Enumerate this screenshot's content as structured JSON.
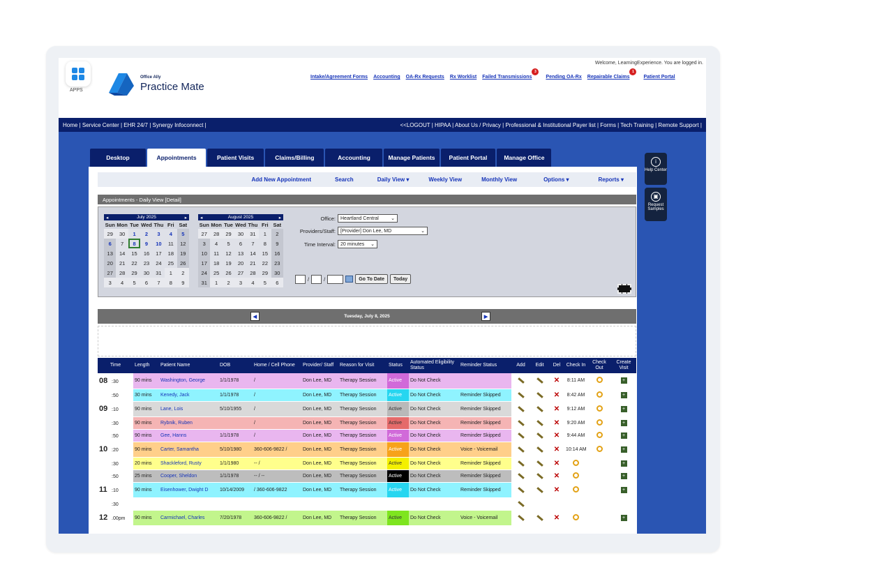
{
  "header": {
    "apps_label": "APPS",
    "brand_top": "Office Ally",
    "brand_name": "Practice Mate",
    "welcome": "Welcome, LearningExperience. You are logged in.",
    "links": [
      {
        "label": "Intake/Agreement Forms"
      },
      {
        "label": "Accounting"
      },
      {
        "label": "OA-Rx Requests"
      },
      {
        "label": "Rx Worklist"
      },
      {
        "label": "Failed Transmissions",
        "badge": "3"
      },
      {
        "label": "Pending OA-Rx"
      },
      {
        "label": "Repairable Claims",
        "badge": "1"
      },
      {
        "label": "Patient Portal"
      }
    ]
  },
  "navbar": {
    "left": "Home | Service Center | EHR 24/7 | Synergy Infoconnect |",
    "right": "<<LOGOUT | HIPAA | About Us / Privacy | Professional & Institutional Payer list | Forms | Tech Training | Remote Support |"
  },
  "tabs": [
    "Desktop",
    "Appointments",
    "Patient Visits",
    "Claims/Billing",
    "Accounting",
    "Manage Patients",
    "Patient Portal",
    "Manage Office"
  ],
  "active_tab": "Appointments",
  "subnav": [
    "Add New Appointment",
    "Search",
    "Daily View ▾",
    "Weekly View",
    "Monthly View",
    "Options ▾",
    "Reports ▾"
  ],
  "section_title": "Appointments - Daily View [Detail]",
  "calendars": [
    {
      "month": "July 2025",
      "weeks": [
        [
          "29",
          "30",
          "1",
          "2",
          "3",
          "4",
          "5"
        ],
        [
          "6",
          "7",
          "8",
          "9",
          "10",
          "11",
          "12"
        ],
        [
          "13",
          "14",
          "15",
          "16",
          "17",
          "18",
          "19"
        ],
        [
          "20",
          "21",
          "22",
          "23",
          "24",
          "25",
          "26"
        ],
        [
          "27",
          "28",
          "29",
          "30",
          "31",
          "1",
          "2"
        ],
        [
          "3",
          "4",
          "5",
          "6",
          "7",
          "8",
          "9"
        ]
      ]
    },
    {
      "month": "August 2025",
      "weeks": [
        [
          "27",
          "28",
          "29",
          "30",
          "31",
          "1",
          "2"
        ],
        [
          "3",
          "4",
          "5",
          "6",
          "7",
          "8",
          "9"
        ],
        [
          "10",
          "11",
          "12",
          "13",
          "14",
          "15",
          "16"
        ],
        [
          "17",
          "18",
          "19",
          "20",
          "21",
          "22",
          "23"
        ],
        [
          "24",
          "25",
          "26",
          "27",
          "28",
          "29",
          "30"
        ],
        [
          "31",
          "1",
          "2",
          "3",
          "4",
          "5",
          "6"
        ]
      ]
    }
  ],
  "weekdays": [
    "Sun",
    "Mon",
    "Tue",
    "Wed",
    "Thu",
    "Fri",
    "Sat"
  ],
  "form": {
    "office_label": "Office:",
    "office_value": "Heartland Central",
    "providers_label": "Providers/Staff:",
    "providers_value": "[Provider] Don Lee, MD",
    "interval_label": "Time Interval:",
    "interval_value": "20 minutes",
    "goto_label": "Go To Date",
    "today_label": "Today"
  },
  "date_bar": "Tuesday, July 8, 2025",
  "table_headers": [
    "Time",
    "Length",
    "Patient Name",
    "DOB",
    "Home / Cell Phone",
    "Provider/ Staff",
    "Reason for Visit",
    "Status",
    "Automated Eligibility Status",
    "Reminder Status",
    "Add",
    "Edit",
    "Del",
    "Check In",
    "Check Out",
    "Create Visit"
  ],
  "rows": [
    {
      "hour": "08",
      "min": ":30",
      "length": "90 mins",
      "name": "Washington, George",
      "dob": "1/1/1978",
      "phone": "/",
      "provider": "Don Lee, MD",
      "reason": "Therapy Session",
      "status": "Active",
      "elig": "Do Not Check",
      "reminder": "",
      "checkin": "8:11 AM",
      "bg": "#e9b6ef",
      "status_bg": "#d16ad9",
      "status_color": "#fff",
      "has_checkout": true
    },
    {
      "hour": "",
      "min": ":50",
      "length": "30 mins",
      "name": "Kenedy, Jack",
      "dob": "1/1/1978",
      "phone": "/",
      "provider": "Don Lee, MD",
      "reason": "Therapy Session",
      "status": "Active",
      "elig": "Do Not Check",
      "reminder": "Reminder Skipped",
      "checkin": "8:42 AM",
      "bg": "#8ff3ff",
      "status_bg": "#27d6f0",
      "status_color": "#fff",
      "has_checkout": true
    },
    {
      "hour": "09",
      "min": ":10",
      "length": "90 mins",
      "name": "Lane, Lois",
      "dob": "5/10/1955",
      "phone": "/",
      "provider": "Don Lee, MD",
      "reason": "Therapy Session",
      "status": "Active",
      "elig": "Do Not Check",
      "reminder": "Reminder Skipped",
      "checkin": "9:12 AM",
      "bg": "#d9d9d9",
      "status_bg": "#b9b9b9",
      "status_color": "#333",
      "has_checkout": true
    },
    {
      "hour": "",
      "min": ":30",
      "length": "90 mins",
      "name": "Rybnik, Ruben",
      "dob": "",
      "phone": "/",
      "provider": "Don Lee, MD",
      "reason": "Therapy Session",
      "status": "Active",
      "elig": "Do Not Check",
      "reminder": "Reminder Skipped",
      "checkin": "9:20 AM",
      "bg": "#f5b4b4",
      "status_bg": "#e56a6a",
      "status_color": "#333",
      "has_checkout": true
    },
    {
      "hour": "",
      "min": ":50",
      "length": "90 mins",
      "name": "Gee, Hanns",
      "dob": "1/1/1978",
      "phone": "/",
      "provider": "Don Lee, MD",
      "reason": "Therapy Session",
      "status": "Active",
      "elig": "Do Not Check",
      "reminder": "Reminder Skipped",
      "checkin": "9:44 AM",
      "bg": "#e9b6ef",
      "status_bg": "#d16ad9",
      "status_color": "#fff",
      "has_checkout": true
    },
    {
      "hour": "10",
      "min": ":20",
      "length": "90 mins",
      "name": "Carter, Samantha",
      "dob": "5/10/1980",
      "phone": "360-606-9822 /",
      "provider": "Don Lee, MD",
      "reason": "Therapy Session",
      "status": "Active",
      "elig": "Do Not Check",
      "reminder": "Voice - Voicemail",
      "checkin": "10:14 AM",
      "bg": "#ffcf8a",
      "status_bg": "#f7a21a",
      "status_color": "#fff",
      "has_checkout": true
    },
    {
      "hour": "",
      "min": ":30",
      "length": "20 mins",
      "name": "Shackleford, Rusty",
      "dob": "1/1/1980",
      "phone": "-- /",
      "provider": "Don Lee, MD",
      "reason": "Therapy Session",
      "status": "Active",
      "elig": "Do Not Check",
      "reminder": "Reminder Skipped",
      "checkin": "",
      "bg": "#ffff8c",
      "status_bg": "#f4f000",
      "status_color": "#333",
      "has_checkout": false
    },
    {
      "hour": "",
      "min": ":50",
      "length": "25 mins",
      "name": "Cooper, Sheldon",
      "dob": "1/1/1978",
      "phone": "-- / --",
      "provider": "Don Lee, MD",
      "reason": "Therapy Session",
      "status": "Active",
      "elig": "Do Not Check",
      "reminder": "Reminder Skipped",
      "checkin": "",
      "bg": "#bdbdbd",
      "status_bg": "#000000",
      "status_color": "#fff",
      "has_checkout": false
    },
    {
      "hour": "11",
      "min": ":10",
      "length": "90 mins",
      "name": "Eisenhower, Dwight D",
      "dob": "10/14/2009",
      "phone": "/ 360-606-9822",
      "provider": "Don Lee, MD",
      "reason": "Therapy Session",
      "status": "Active",
      "elig": "Do Not Check",
      "reminder": "Reminder Skipped",
      "checkin": "",
      "bg": "#8ff3ff",
      "status_bg": "#27d6f0",
      "status_color": "#fff",
      "has_checkout": false
    },
    {
      "hour": "",
      "min": ":30",
      "length": "",
      "name": "",
      "dob": "",
      "phone": "",
      "provider": "",
      "reason": "",
      "status": "",
      "elig": "",
      "reminder": "",
      "checkin": "",
      "bg": "#ffffff",
      "status_bg": "#ffffff",
      "status_color": "#333",
      "has_checkout": false,
      "empty": true
    },
    {
      "hour": "12",
      "min": ".00pm",
      "length": "90 mins",
      "name": "Carmichael, Charles",
      "dob": "7/20/1978",
      "phone": "360-606-9822 /",
      "provider": "Don Lee, MD",
      "reason": "Therapy Session",
      "status": "Active",
      "elig": "Do Not Check",
      "reminder": "Voice - Voicemail",
      "checkin": "",
      "bg": "#c2f58c",
      "status_bg": "#7ee51f",
      "status_color": "#333",
      "has_checkout": false
    }
  ],
  "side_tools": [
    {
      "label": "Help Center",
      "icon": "info-icon"
    },
    {
      "label": "Request Samples",
      "icon": "sample-icon"
    }
  ]
}
